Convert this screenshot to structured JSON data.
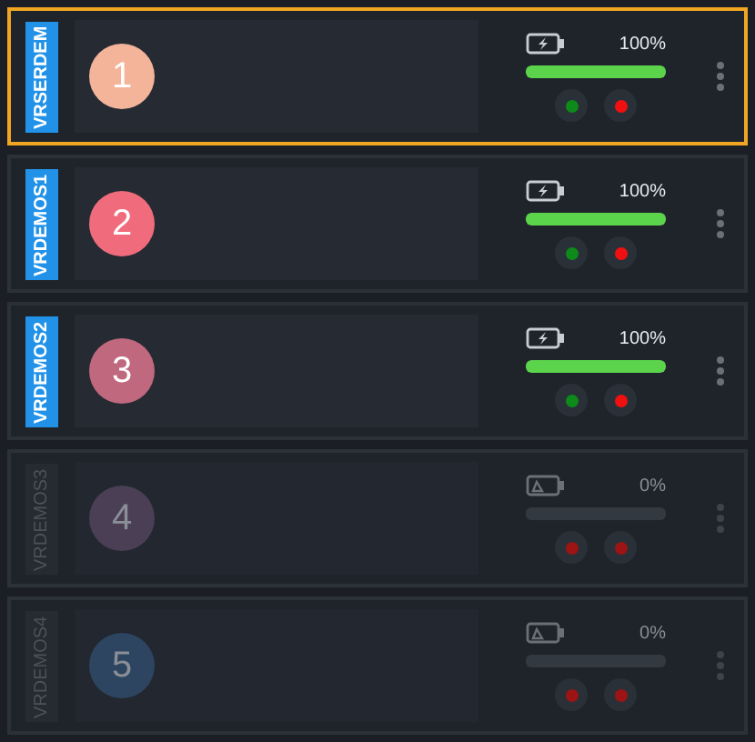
{
  "devices": [
    {
      "name": "VRSERDEM",
      "number": "1",
      "color": "#f4b49a",
      "selected": true,
      "online": true,
      "level": 1,
      "reading": "100%"
    },
    {
      "name": "VRDEMOS1",
      "number": "2",
      "color": "#f06c7c",
      "selected": false,
      "online": true,
      "level": 1,
      "reading": "100%"
    },
    {
      "name": "VRDEMOS2",
      "number": "3",
      "color": "#c0687e",
      "selected": false,
      "online": true,
      "level": 1,
      "reading": "100%"
    },
    {
      "name": "VRDEMOS3",
      "number": "4",
      "color": "#4a3f55",
      "selected": false,
      "online": false,
      "level": 0,
      "reading": "0%"
    },
    {
      "name": "VRDEMOS4",
      "number": "5",
      "color": "#2d4560",
      "selected": false,
      "online": false,
      "level": 0,
      "reading": "0%"
    }
  ]
}
